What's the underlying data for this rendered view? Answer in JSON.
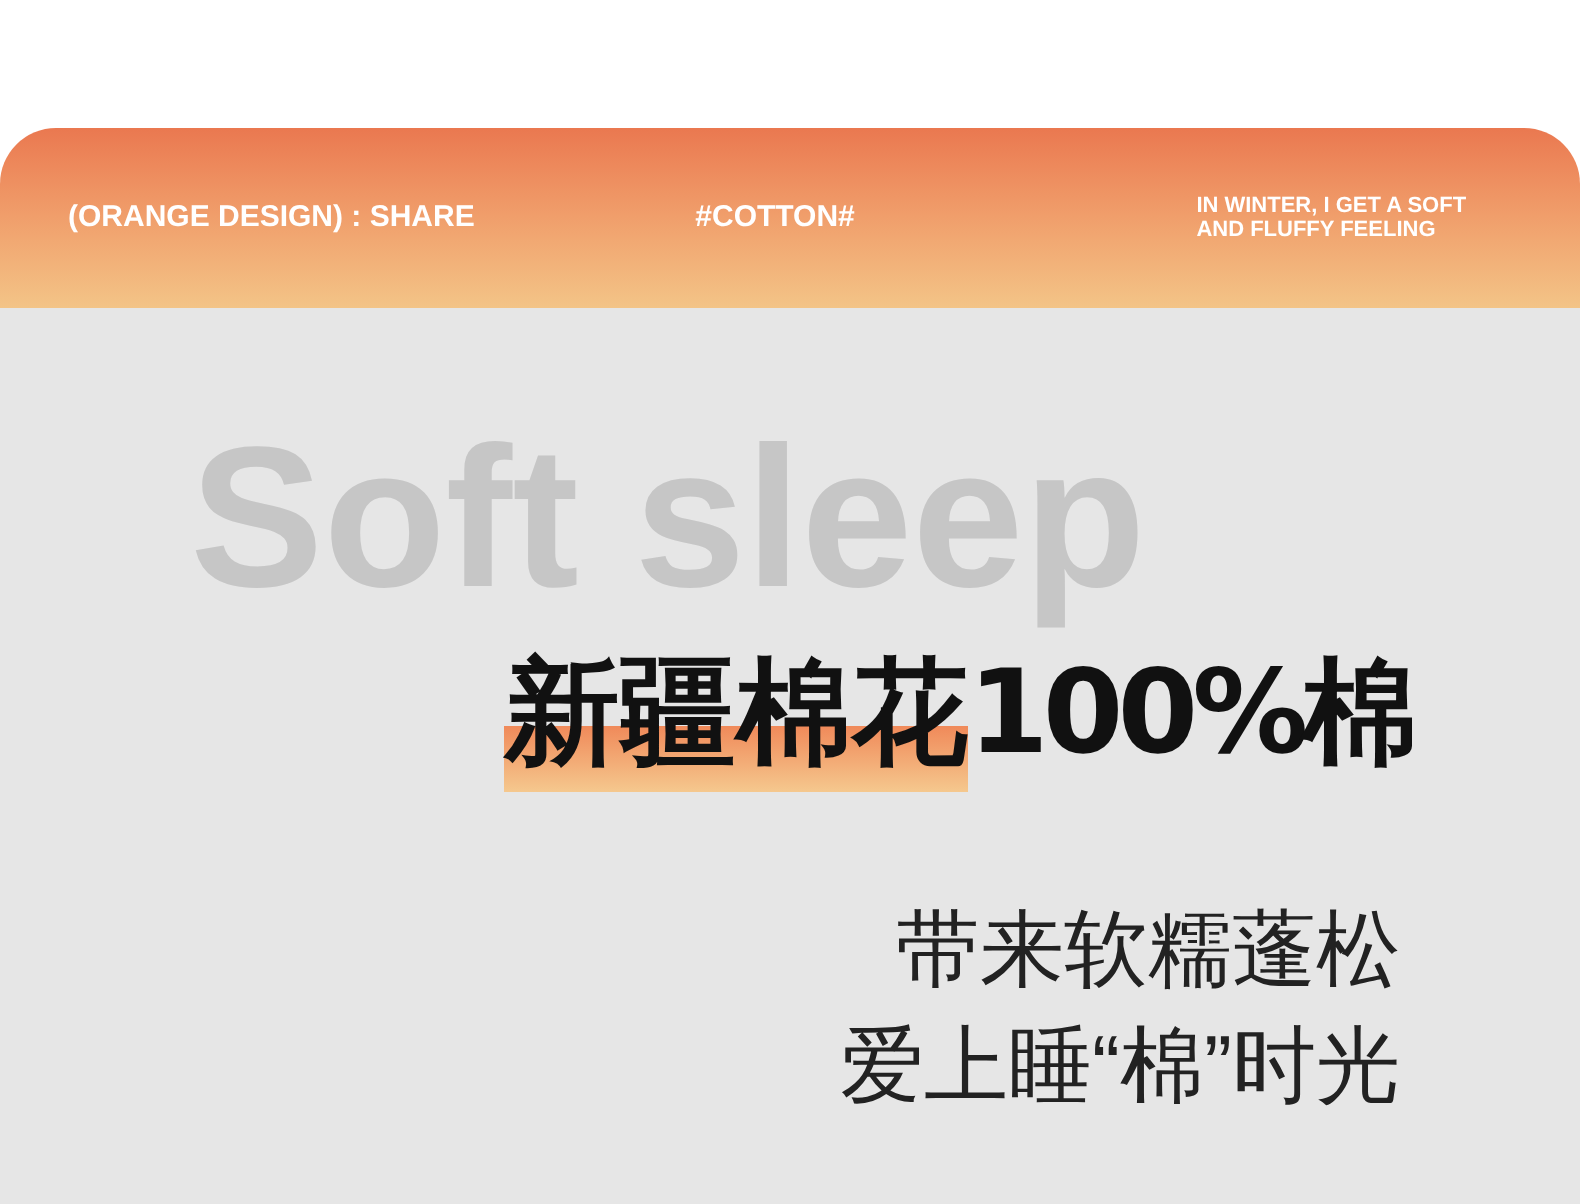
{
  "header": {
    "items": [
      "(ORANGE DESIGN) : SHARE",
      "#COTTON#",
      "IN WINTER, I GET A SOFT AND FLUFFY FEELING"
    ]
  },
  "background_text": "Soft sleep",
  "headline": {
    "highlighted": "新疆棉花",
    "rest": "100%棉"
  },
  "tagline": [
    "带来软糯蓬松",
    "爱上睡“棉”时光"
  ]
}
